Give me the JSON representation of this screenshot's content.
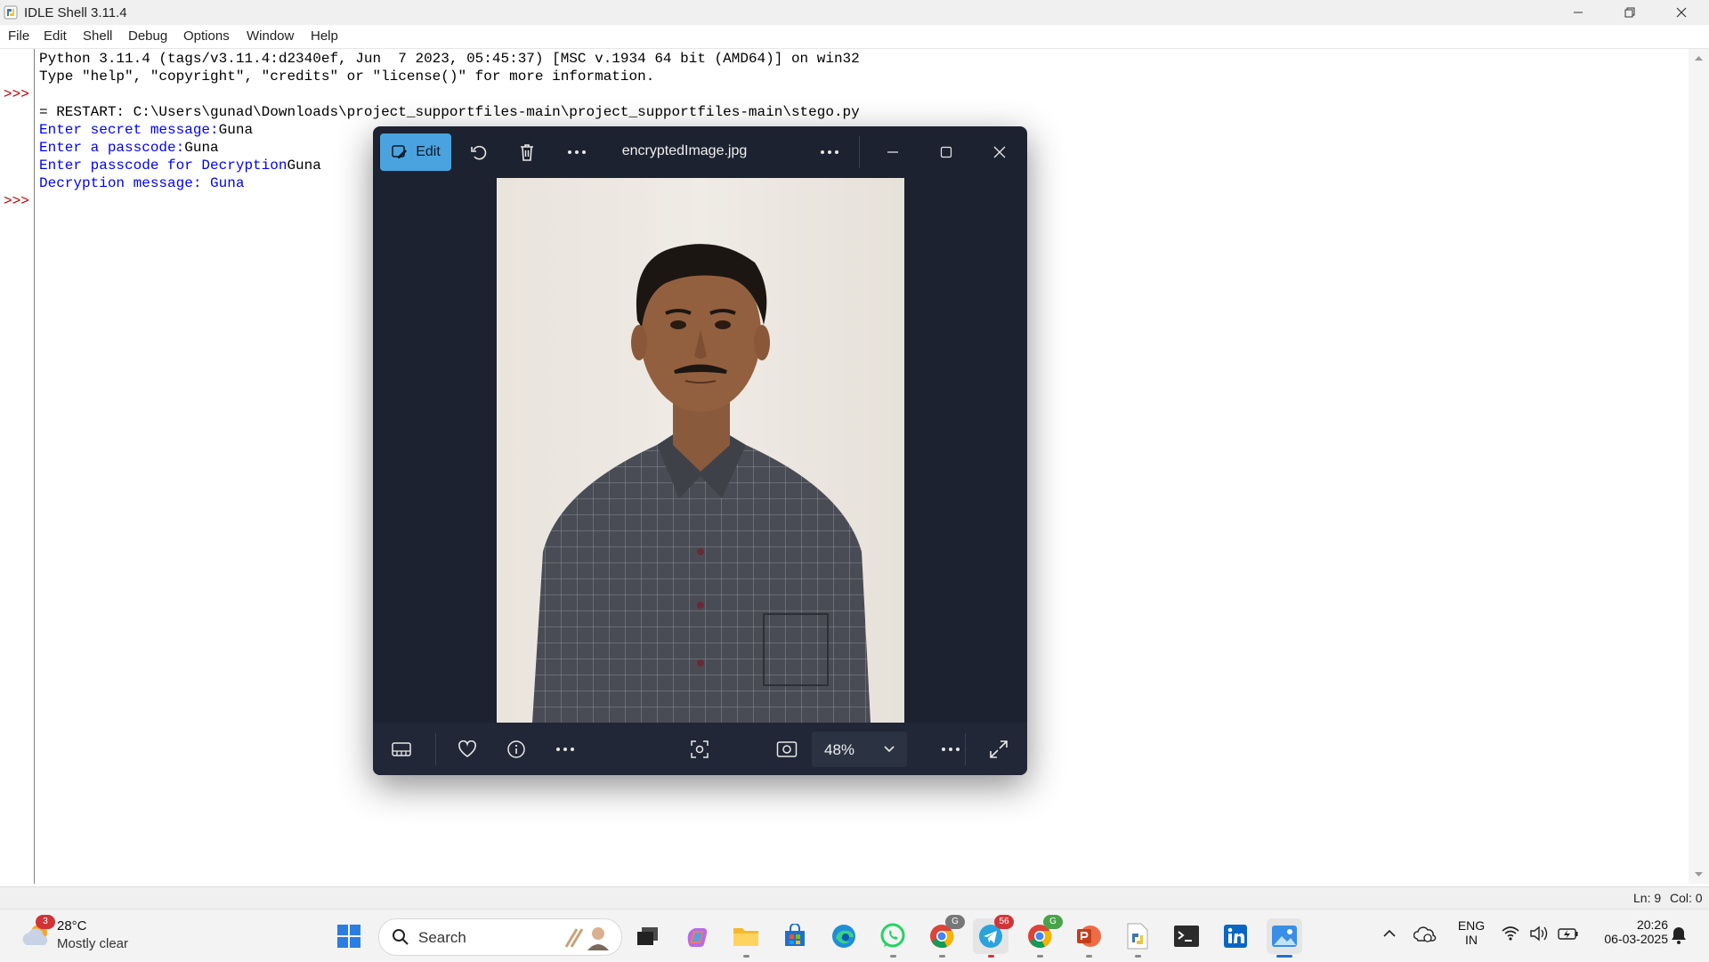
{
  "idle": {
    "title": "IDLE Shell 3.11.4",
    "menu": [
      "File",
      "Edit",
      "Shell",
      "Debug",
      "Options",
      "Window",
      "Help"
    ],
    "prompt": ">>>",
    "lines": {
      "l1": "Python 3.11.4 (tags/v3.11.4:d2340ef, Jun  7 2023, 05:45:37) [MSC v.1934 64 bit (AMD64)] on win32",
      "l2": "Type \"help\", \"copyright\", \"credits\" or \"license()\" for more information.",
      "l3": "= RESTART: C:\\Users\\gunad\\Downloads\\project_supportfiles-main\\project_supportfiles-main\\stego.py",
      "l4_prompt": "Enter secret message:",
      "l4_input": "Guna",
      "l5_prompt": "Enter a passcode:",
      "l5_input": "Guna",
      "l6_prompt": "Enter passcode for Decryption",
      "l6_input": "Guna",
      "l7": "Decryption message: Guna"
    },
    "status": {
      "ln": "Ln: 9",
      "col": "Col: 0"
    }
  },
  "viewer": {
    "edit_label": "Edit",
    "filename": "encryptedImage.jpg",
    "zoom": "48%"
  },
  "taskbar": {
    "weather_temp": "28°C",
    "weather_cond": "Mostly clear",
    "weather_badge": "3",
    "search_label": "Search",
    "telegram_badge": "56",
    "chrome_badge": "G",
    "lang_top": "ENG",
    "lang_bottom": "IN",
    "time": "20:26",
    "date": "06-03-2025"
  },
  "colors": {
    "prompt": "#c00000",
    "stdout_blue": "#0000ff",
    "viewer_bg": "#1d2230",
    "edit_accent": "#4aa3df"
  }
}
